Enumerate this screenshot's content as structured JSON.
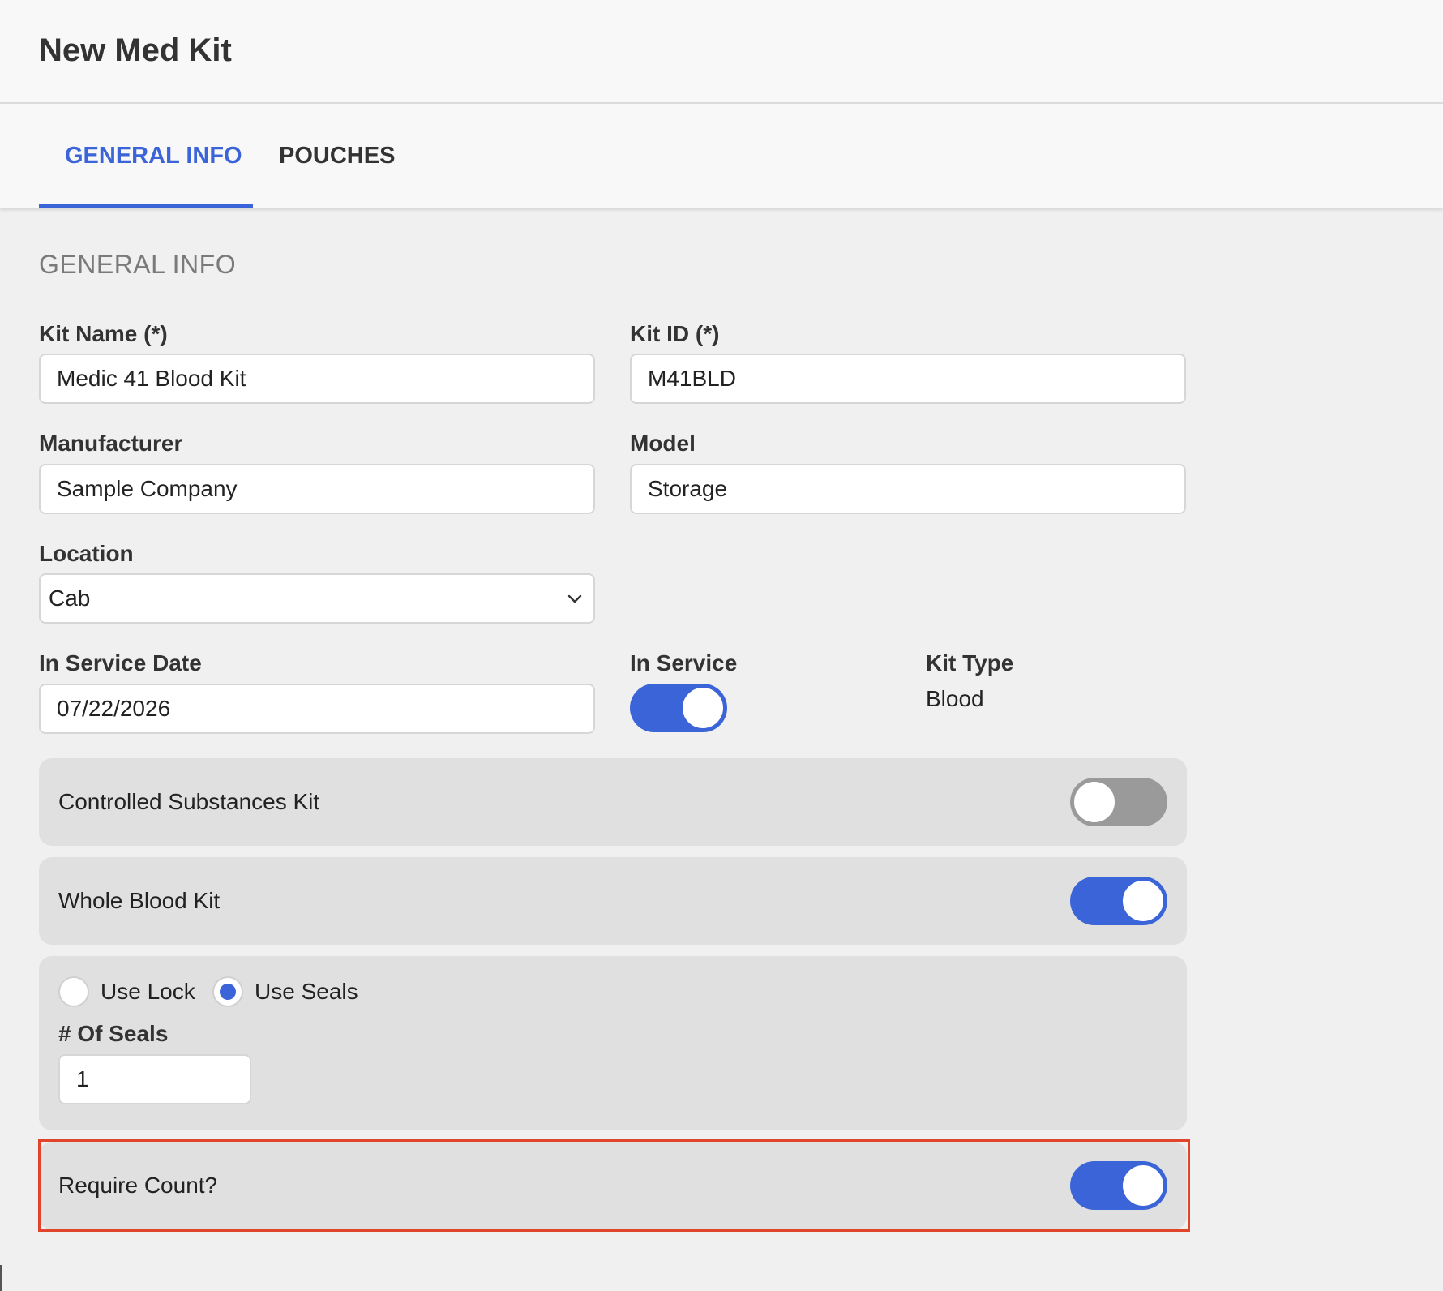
{
  "header": {
    "title": "New Med Kit"
  },
  "tabs": [
    {
      "label": "GENERAL INFO",
      "active": true
    },
    {
      "label": "POUCHES",
      "active": false
    }
  ],
  "section": {
    "title": "GENERAL INFO"
  },
  "fields": {
    "kit_name": {
      "label": "Kit Name (*)",
      "value": "Medic 41 Blood Kit"
    },
    "kit_id": {
      "label": "Kit ID (*)",
      "value": "M41BLD"
    },
    "manufacturer": {
      "label": "Manufacturer",
      "value": "Sample Company"
    },
    "model": {
      "label": "Model",
      "value": "Storage"
    },
    "location": {
      "label": "Location",
      "value": "Cab"
    },
    "in_service_date": {
      "label": "In Service Date",
      "value": "07/22/2026"
    },
    "in_service": {
      "label": "In Service",
      "on": true
    },
    "kit_type": {
      "label": "Kit Type",
      "value": "Blood"
    }
  },
  "panels": {
    "controlled": {
      "label": "Controlled Substances Kit",
      "on": false
    },
    "whole_blood": {
      "label": "Whole Blood Kit",
      "on": true
    },
    "seals": {
      "radio_lock": "Use Lock",
      "radio_seals": "Use Seals",
      "selected": "Use Seals",
      "count_label": "# Of Seals",
      "count_value": "1"
    },
    "require_count": {
      "label": "Require Count?",
      "on": true
    }
  },
  "colors": {
    "accent": "#3a64d8",
    "highlight": "#e0452c"
  },
  "icons": {
    "location_dropdown": "chevron-down-icon"
  }
}
